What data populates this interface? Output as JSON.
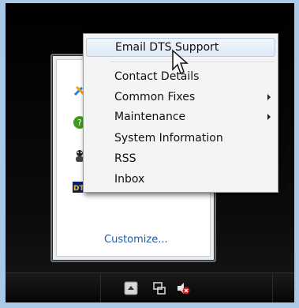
{
  "menu": {
    "items": [
      {
        "label": "Email DTS Support",
        "submenu": false
      },
      {
        "label": "Contact Details",
        "submenu": false
      },
      {
        "label": "Common Fixes",
        "submenu": true
      },
      {
        "label": "Maintenance",
        "submenu": true
      },
      {
        "label": "System Information",
        "submenu": false
      },
      {
        "label": "RSS",
        "submenu": false
      },
      {
        "label": "Inbox",
        "submenu": false
      }
    ]
  },
  "flyout": {
    "customize_label": "Customize...",
    "icons": [
      "tools-icon",
      "green-circle-icon",
      "chat-icon",
      "dts-logo-icon"
    ]
  },
  "taskbar": {
    "icons": [
      "show-hidden-icons-button",
      "network-icon",
      "volume-muted-icon"
    ]
  },
  "colors": {
    "link": "#1d5aa8",
    "hover_bg": "#dde9f6",
    "taskbar": "#050505"
  }
}
